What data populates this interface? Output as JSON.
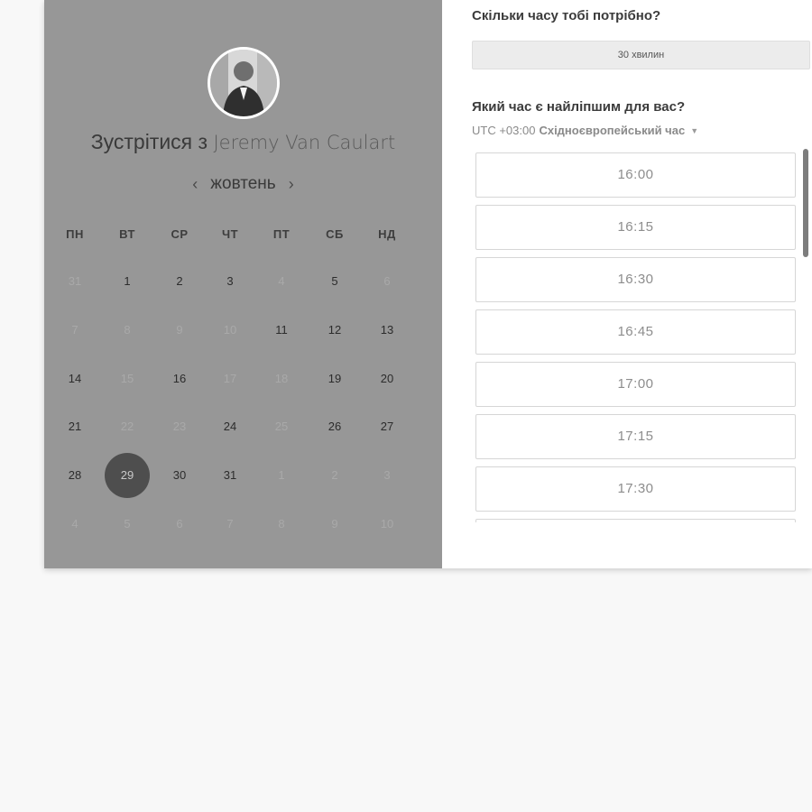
{
  "header": {
    "meet_prefix": "Зустрітися з",
    "host_name": "Jeremy Van Caulart"
  },
  "calendar": {
    "month": "жовтень",
    "prev_icon": "chevron-left-icon",
    "next_icon": "chevron-right-icon",
    "weekdays": [
      "ПН",
      "ВТ",
      "СР",
      "ЧТ",
      "ПТ",
      "СБ",
      "НД"
    ],
    "weeks": [
      [
        {
          "d": "31",
          "s": "muted"
        },
        {
          "d": "1",
          "s": "available"
        },
        {
          "d": "2",
          "s": "available"
        },
        {
          "d": "3",
          "s": "available"
        },
        {
          "d": "4",
          "s": "muted"
        },
        {
          "d": "5",
          "s": "available"
        },
        {
          "d": "6",
          "s": "muted"
        }
      ],
      [
        {
          "d": "7",
          "s": "muted"
        },
        {
          "d": "8",
          "s": "muted"
        },
        {
          "d": "9",
          "s": "muted"
        },
        {
          "d": "10",
          "s": "muted"
        },
        {
          "d": "11",
          "s": "available"
        },
        {
          "d": "12",
          "s": "available"
        },
        {
          "d": "13",
          "s": "available"
        }
      ],
      [
        {
          "d": "14",
          "s": "available"
        },
        {
          "d": "15",
          "s": "muted"
        },
        {
          "d": "16",
          "s": "available"
        },
        {
          "d": "17",
          "s": "muted"
        },
        {
          "d": "18",
          "s": "muted"
        },
        {
          "d": "19",
          "s": "available"
        },
        {
          "d": "20",
          "s": "available"
        }
      ],
      [
        {
          "d": "21",
          "s": "available"
        },
        {
          "d": "22",
          "s": "muted"
        },
        {
          "d": "23",
          "s": "muted"
        },
        {
          "d": "24",
          "s": "available"
        },
        {
          "d": "25",
          "s": "muted"
        },
        {
          "d": "26",
          "s": "available"
        },
        {
          "d": "27",
          "s": "available"
        }
      ],
      [
        {
          "d": "28",
          "s": "available"
        },
        {
          "d": "29",
          "s": "selected"
        },
        {
          "d": "30",
          "s": "available"
        },
        {
          "d": "31",
          "s": "available"
        },
        {
          "d": "1",
          "s": "muted"
        },
        {
          "d": "2",
          "s": "muted"
        },
        {
          "d": "3",
          "s": "muted"
        }
      ],
      [
        {
          "d": "4",
          "s": "muted"
        },
        {
          "d": "5",
          "s": "muted"
        },
        {
          "d": "6",
          "s": "muted"
        },
        {
          "d": "7",
          "s": "muted"
        },
        {
          "d": "8",
          "s": "muted"
        },
        {
          "d": "9",
          "s": "muted"
        },
        {
          "d": "10",
          "s": "muted"
        }
      ]
    ],
    "selected_day": "29"
  },
  "booking": {
    "duration_question": "Скільки часу тобі потрібно?",
    "duration_value": "30 хвилин",
    "time_question": "Який час є найліпшим для вас?",
    "timezone_offset": "UTC +03:00",
    "timezone_name": "Східноєвропейський час",
    "timezone_caret_icon": "caret-down-icon",
    "slots": [
      "16:00",
      "16:15",
      "16:30",
      "16:45",
      "17:00",
      "17:15",
      "17:30",
      ""
    ]
  },
  "colors": {
    "left_panel_bg": "#979797",
    "selected_day_bg": "#4e4e4e",
    "page_bg": "#f8f8f8"
  }
}
